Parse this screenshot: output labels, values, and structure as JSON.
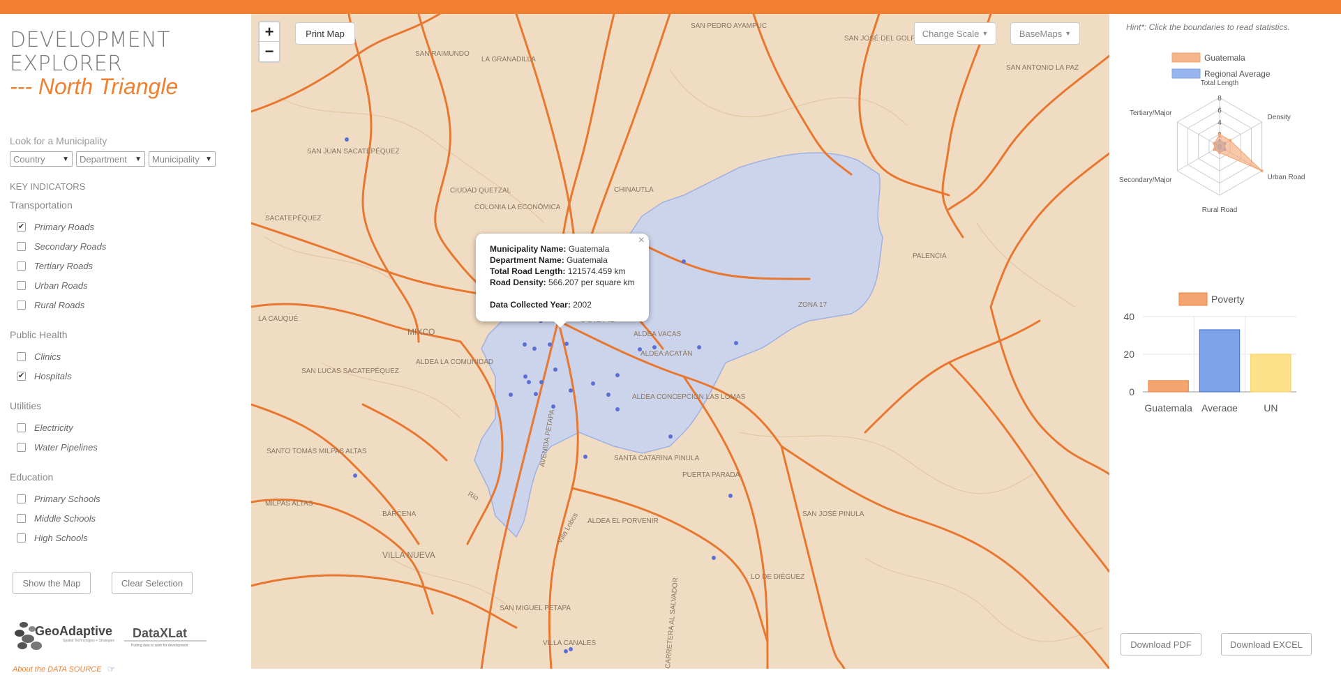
{
  "app": {
    "title_line1": "DEVELOPMENT",
    "title_line2": "EXPLORER",
    "subtitle": "--- North Triangle"
  },
  "search": {
    "label": "Look for a Municipality",
    "country": "Country",
    "department": "Department",
    "municipality": "Municipality"
  },
  "indicators": {
    "heading": "KEY INDICATORS",
    "transportation": {
      "title": "Transportation",
      "items": [
        {
          "label": "Primary Roads",
          "checked": true
        },
        {
          "label": "Secondary Roads",
          "checked": false
        },
        {
          "label": "Tertiary Roads",
          "checked": false
        },
        {
          "label": "Urban Roads",
          "checked": false
        },
        {
          "label": "Rural Roads",
          "checked": false
        }
      ]
    },
    "health": {
      "title": "Public Health",
      "items": [
        {
          "label": "Clinics",
          "checked": false
        },
        {
          "label": "Hospitals",
          "checked": true
        }
      ]
    },
    "utilities": {
      "title": "Utilities",
      "items": [
        {
          "label": "Electricity",
          "checked": false
        },
        {
          "label": "Water Pipelines",
          "checked": false
        }
      ]
    },
    "education": {
      "title": "Education",
      "items": [
        {
          "label": "Primary Schools",
          "checked": false
        },
        {
          "label": "Middle Schools",
          "checked": false
        },
        {
          "label": "High Schools",
          "checked": false
        }
      ]
    }
  },
  "buttons": {
    "show_map": "Show the Map",
    "clear": "Clear Selection",
    "print": "Print Map",
    "change_scale": "Change Scale",
    "basemaps": "BaseMaps",
    "zoom_in": "+",
    "zoom_out": "−",
    "download_pdf": "Download PDF",
    "download_excel": "Download EXCEL"
  },
  "logos": {
    "geo_name": "GeoAdaptive",
    "geo_tag": "Spatial Technologies + Strategies",
    "dx_name": "DataXLat",
    "dx_tag": "Putting data to work for development"
  },
  "about": "About the DATA SOURCE",
  "popup": {
    "muni_label": "Municipality Name:",
    "muni_value": "Guatemala",
    "dept_label": "Department Name:",
    "dept_value": "Guatemala",
    "length_label": "Total Road Length:",
    "length_value": "121574.459 km",
    "density_label": "Road Density:",
    "density_value": "566.207 per square km",
    "year_label": "Data Collected Year:",
    "year_value": "2002",
    "close": "×"
  },
  "map_labels": [
    "SAN PEDRO AYAMPUC",
    "SAN RAIMUNDO",
    "LA GRANADILLA",
    "SAN JOSÉ DEL GOLFO",
    "SAN ANTONIO LA PAZ",
    "SAN JUAN SACATEPÉQUEZ",
    "CIUDAD QUETZAL",
    "CHINAUTLA",
    "COLONIA LA ECONÓMICA",
    "SACATEPÉQUEZ",
    "PALENCIA",
    "LA CAUQUÉ",
    "MIXCO",
    "ALDEA LA COMUNIDAD",
    "ALDEA VACAS",
    "ALDEA ACATÁN",
    "ZONA 17",
    "SAN LUCAS SACATEPÉQUEZ",
    "ALDEA CONCEPCIÓN LAS LOMAS",
    "SANTO TOMÁS MILPAS ALTAS",
    "MILPAS ALTAS",
    "SANTA CATARINA PINULA",
    "PUERTA PARADA",
    "BÁRCENA",
    "ALDEA EL PORVENIR",
    "SAN JOSÉ PINULA",
    "VILLA NUEVA",
    "LO DE DIÉGUEZ",
    "SAN MIGUEL PETAPA",
    "VILLA CANALES",
    "CUIDAD",
    "AVENIDA PETAPA",
    "Villa Lobos",
    "Río",
    "CARRETERA AL SALVADOR"
  ],
  "right_panel": {
    "hint": "Hint*: Click the boundaries to read statistics."
  },
  "colors": {
    "accent": "#f0802f",
    "guatemala": "#f4a46f",
    "average": "#7ea2e8",
    "un": "#fde08a"
  },
  "chart_data": [
    {
      "type": "radar",
      "title": "",
      "axes": [
        "Total Length",
        "Density",
        "Urban Road",
        "Rural Road",
        "Secondary/Major",
        "Tertiary/Major"
      ],
      "ticks": [
        "0",
        "2",
        "4",
        "6",
        "8"
      ],
      "max": 8,
      "legend": [
        "Guatemala",
        "Regional Average"
      ],
      "legend_position": "top",
      "series": [
        {
          "name": "Guatemala",
          "values": [
            2,
            2,
            8,
            1,
            1,
            1
          ]
        },
        {
          "name": "Regional Average",
          "values": [
            1,
            1,
            1,
            1,
            1,
            1
          ]
        }
      ]
    },
    {
      "type": "bar",
      "legend": [
        "Poverty"
      ],
      "legend_position": "top",
      "categories": [
        "Guatemala",
        "Average",
        "UN"
      ],
      "values": [
        6,
        33,
        20
      ],
      "yticks": [
        "0",
        "20",
        "40"
      ],
      "ylim": [
        0,
        40
      ],
      "xlabel": "",
      "ylabel": "",
      "grid": true
    }
  ]
}
